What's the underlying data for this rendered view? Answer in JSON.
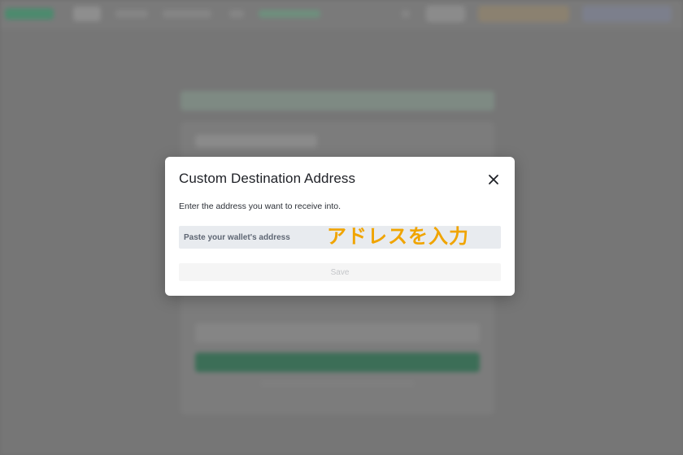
{
  "modal": {
    "title": "Custom Destination Address",
    "description": "Enter the address you want to receive into.",
    "address_placeholder": "Paste your wallet's address",
    "address_value": "",
    "annotation": "アドレスを入力",
    "save_label": "Save",
    "close_icon": "close-icon"
  },
  "colors": {
    "overlay": "#6f6f6f",
    "modal_bg": "#ffffff",
    "input_bg": "#e8ebef",
    "annotation": "#f0a400",
    "disabled_text": "#c4c6c9",
    "brand_green": "#0a5a3e"
  }
}
